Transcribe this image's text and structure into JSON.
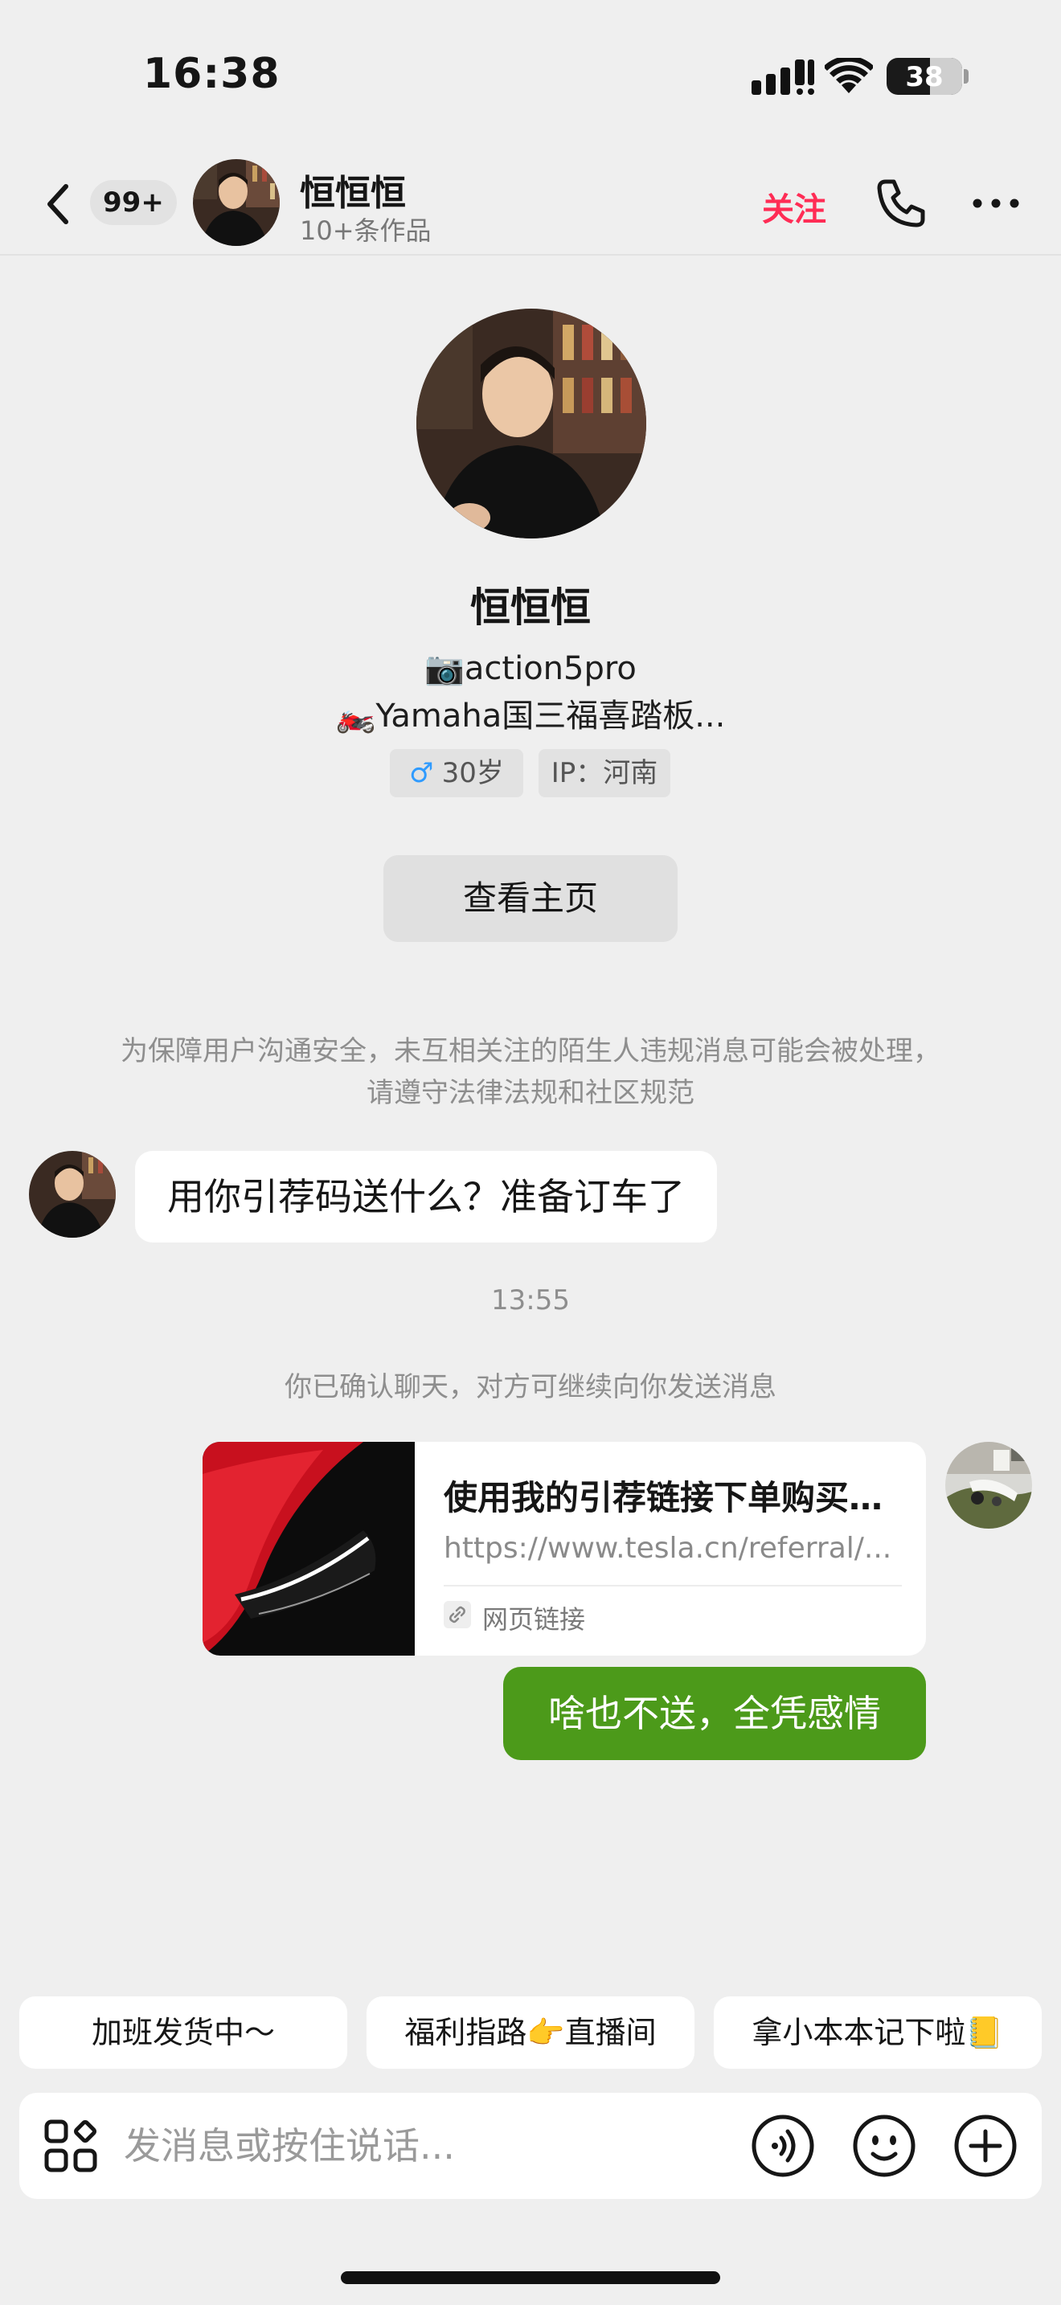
{
  "status_bar": {
    "time": "16:38",
    "battery": "38"
  },
  "header": {
    "unread_badge": "99+",
    "name": "恒恒恒",
    "subtitle": "10+条作品",
    "follow_label": "关注"
  },
  "profile": {
    "name": "恒恒恒",
    "bio_line_1": "📷action5pro",
    "bio_line_2": "🏍️Yamaha国三福喜踏板...",
    "gender_symbol": "♂",
    "age": "30岁",
    "ip": "IP：河南",
    "homepage_button": "查看主页"
  },
  "safety_notice": "为保障用户沟通安全，未互相关注的陌生人违规消息可能会被处理，请遵守法律法规和社区规范",
  "messages": {
    "incoming_1": "用你引荐码送什么？准备订车了",
    "timestamp": "13:55",
    "confirm_note": "你已确认聊天，对方可继续向你发送消息",
    "link_card": {
      "title": "使用我的引荐链接下单购买…",
      "url": "https://www.tesla.cn/referral/...",
      "type_label": "网页链接"
    },
    "outgoing_1": "啥也不送，全凭感情"
  },
  "quick_replies": [
    "加班发货中～",
    "福利指路👉直播间",
    "拿小本本记下啦📒"
  ],
  "input": {
    "placeholder": "发消息或按住说话..."
  },
  "colors": {
    "follow": "#ff2c55",
    "outgoing_bubble": "#4c9a1a",
    "background": "#efefef",
    "gender": "#2f9bff"
  }
}
